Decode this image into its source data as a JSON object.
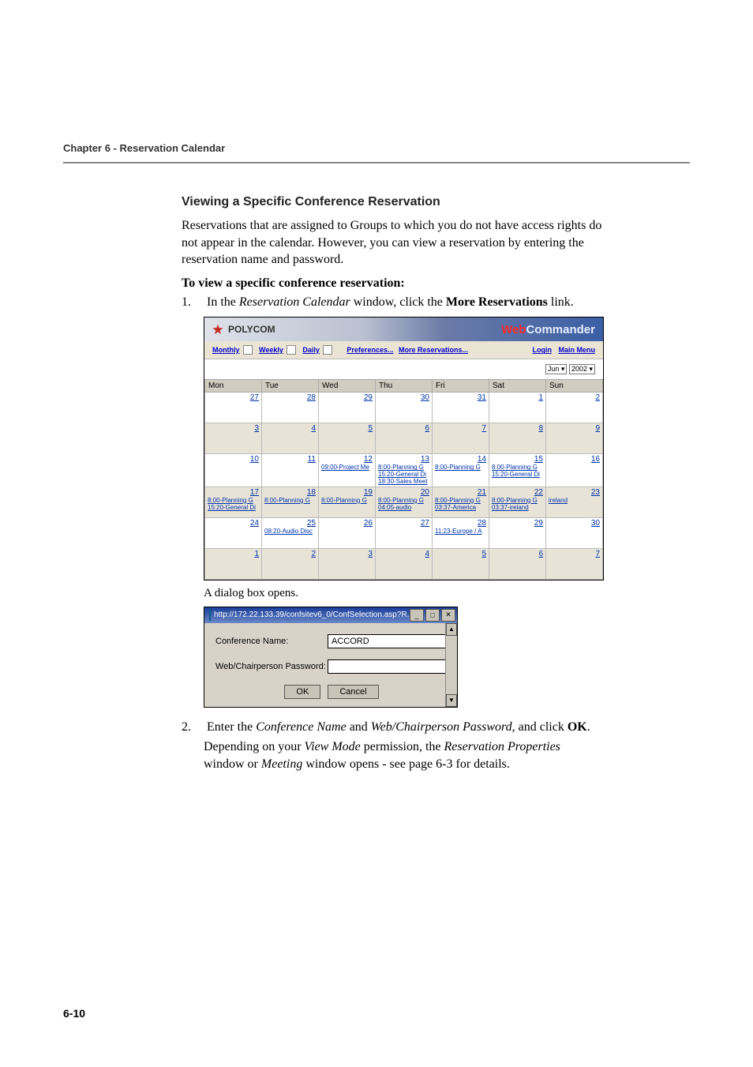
{
  "chapter_header": "Chapter 6 - Reservation Calendar",
  "section_title": "Viewing a Specific Conference Reservation",
  "intro_para": "Reservations that are assigned to Groups to which you do not have access rights do not appear in the calendar. However, you can view a reservation by entering the reservation name and password.",
  "procedure_title": "To view a specific conference reservation:",
  "step1_num": "1.",
  "step1_a": "In the ",
  "step1_b": "Reservation Calendar",
  "step1_c": " window, click the ",
  "step1_d": "More Reservations",
  "step1_e": " link.",
  "caption_dialog": "A dialog box opens.",
  "step2_num": "2.",
  "step2_a": "Enter the ",
  "step2_b": "Conference Name",
  "step2_c": " and ",
  "step2_d": "Web/Chairperson Password,",
  "step2_e": " and click ",
  "step2_f": "OK",
  "step2_g": ".",
  "step2_follow_a": "Depending on your ",
  "step2_follow_b": "View Mode",
  "step2_follow_c": " permission, the ",
  "step2_follow_d": "Reservation Properties",
  "step2_follow_e": " window or ",
  "step2_follow_f": "Meeting",
  "step2_follow_g": " window opens - see page 6-3 for details.",
  "page_number": "6-10",
  "cal": {
    "brand": "POLYCOM",
    "title_a": "Web",
    "title_b": "Commander",
    "view_monthly": "Monthly",
    "view_weekly": "Weekly",
    "view_daily": "Daily",
    "pref": "Preferences...",
    "more_res": "More Reservations...",
    "login": "Login",
    "main_menu": "Main Menu",
    "month_sel": "Jun",
    "year_sel": "2002",
    "days": [
      "Mon",
      "Tue",
      "Wed",
      "Thu",
      "Fri",
      "Sat",
      "Sun"
    ],
    "weeks": [
      [
        {
          "n": "27"
        },
        {
          "n": "28"
        },
        {
          "n": "29"
        },
        {
          "n": "30"
        },
        {
          "n": "31"
        },
        {
          "n": "1"
        },
        {
          "n": "2"
        }
      ],
      [
        {
          "n": "3"
        },
        {
          "n": "4"
        },
        {
          "n": "5"
        },
        {
          "n": "6"
        },
        {
          "n": "7"
        },
        {
          "n": "8"
        },
        {
          "n": "9"
        }
      ],
      [
        {
          "n": "10"
        },
        {
          "n": "11"
        },
        {
          "n": "12",
          "ev": [
            "09:00-Project Me"
          ]
        },
        {
          "n": "13",
          "ev": [
            "8:00-Planning G",
            "15:20-General Di",
            "18:30-Sales Meet"
          ]
        },
        {
          "n": "14",
          "ev": [
            "8:00-Planning G"
          ]
        },
        {
          "n": "15",
          "ev": [
            "8:00-Planning G",
            "15:20-General Di"
          ]
        },
        {
          "n": "16"
        }
      ],
      [
        {
          "n": "17",
          "ev": [
            "8:00-Planning G",
            "15:20-General Di"
          ]
        },
        {
          "n": "18",
          "ev": [
            "8:00-Planning G"
          ]
        },
        {
          "n": "19",
          "ev": [
            "8:00-Planning G"
          ]
        },
        {
          "n": "20",
          "ev": [
            "8:00-Planning G",
            "04:05-audio"
          ]
        },
        {
          "n": "21",
          "ev": [
            "8:00-Planning G",
            "03:37-America"
          ]
        },
        {
          "n": "22",
          "ev": [
            "8:00-Planning G",
            "03:37-ireland"
          ]
        },
        {
          "n": "23",
          "ev": [
            "ireland"
          ]
        }
      ],
      [
        {
          "n": "24"
        },
        {
          "n": "25",
          "ev": [
            "08:20-Audio Disc"
          ]
        },
        {
          "n": "26"
        },
        {
          "n": "27"
        },
        {
          "n": "28",
          "ev": [
            "11:23-Europe / A"
          ]
        },
        {
          "n": "29"
        },
        {
          "n": "30"
        }
      ],
      [
        {
          "n": "1"
        },
        {
          "n": "2"
        },
        {
          "n": "3"
        },
        {
          "n": "4"
        },
        {
          "n": "5"
        },
        {
          "n": "6"
        },
        {
          "n": "7"
        }
      ]
    ]
  },
  "dlg": {
    "title": "http://172.22.133.39/confsitev6_0/ConfSelection.asp?R...",
    "lbl_conf": "Conference Name:",
    "val_conf": "ACCORD",
    "lbl_pwd": "Web/Chairperson Password:",
    "val_pwd": "",
    "ok": "OK",
    "cancel": "Cancel",
    "min": "_",
    "max": "□",
    "close": "✕",
    "up": "▲",
    "down": "▼"
  }
}
